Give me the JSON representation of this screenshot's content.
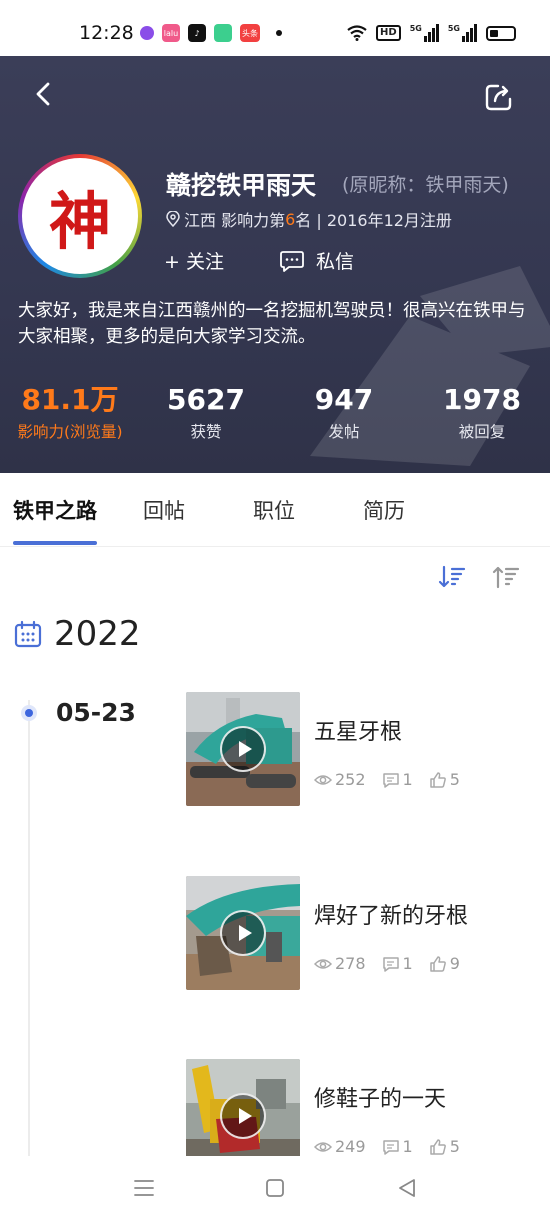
{
  "status_bar": {
    "time": "12:28",
    "apps": [
      {
        "name": "circle-app-icon",
        "color": "#8a4de8",
        "label": ""
      },
      {
        "name": "chat-app-icon",
        "color": "#f05a8a",
        "label": "lalu"
      },
      {
        "name": "tiktok-app-icon",
        "color": "#111111",
        "label": "♪"
      },
      {
        "name": "message-app-icon",
        "color": "#3ccf8e",
        "label": ""
      },
      {
        "name": "toutiao-app-icon",
        "color": "#f24040",
        "label": "头条"
      }
    ],
    "hd_label": "HD",
    "net1": "5G",
    "net2": "5G"
  },
  "profile": {
    "avatar_char": "神",
    "nickname": "赣挖铁甲雨天",
    "original_name": "(原昵称：铁甲雨天)",
    "meta_prefix": "江西 影响力第",
    "rank": "6",
    "meta_suffix": "名 | 2016年12月注册",
    "follow_label": "+ 关注",
    "message_label": "私信",
    "bio": "大家好，我是来自江西赣州的一名挖掘机驾驶员！很高兴在铁甲与大家相聚，更多的是向大家学习交流。"
  },
  "stats": [
    {
      "value": "81.1万",
      "label": "影响力(浏览量)"
    },
    {
      "value": "5627",
      "label": "获赞"
    },
    {
      "value": "947",
      "label": "发帖"
    },
    {
      "value": "1978",
      "label": "被回复"
    }
  ],
  "tabs": [
    "铁甲之路",
    "回帖",
    "职位",
    "简历"
  ],
  "timeline": {
    "year": "2022",
    "date": "05-23",
    "posts": [
      {
        "title": "五星牙根",
        "views": "252",
        "comments": "1",
        "likes": "5"
      },
      {
        "title": "焊好了新的牙根",
        "views": "278",
        "comments": "1",
        "likes": "9"
      },
      {
        "title": "修鞋子的一天",
        "views": "249",
        "comments": "1",
        "likes": "5"
      }
    ]
  },
  "colors": {
    "header_bg": "#383b55",
    "accent_orange": "#ff7a1a",
    "accent_blue": "#4a6fd6"
  }
}
